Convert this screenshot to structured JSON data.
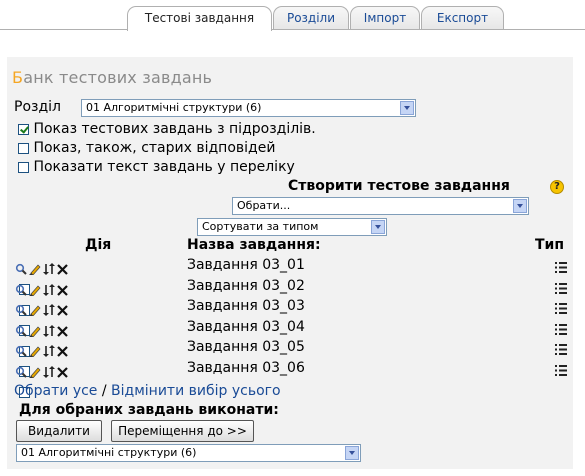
{
  "tabs": [
    {
      "label": "Тестові завдання",
      "active": true
    },
    {
      "label": "Розділи",
      "active": false
    },
    {
      "label": "Імпорт",
      "active": false
    },
    {
      "label": "Експорт",
      "active": false
    }
  ],
  "heading": {
    "first_letter": "Б",
    "rest": "анк тестових завдань"
  },
  "category": {
    "label": "Розділ",
    "selected": "01 Алгоритмічні структури (6)"
  },
  "options": [
    {
      "label": "Показ тестових завдань з підрозділів.",
      "checked": true
    },
    {
      "label": "Показ, також, старих відповідей",
      "checked": false
    },
    {
      "label": "Показати текст завдань у переліку",
      "checked": false
    }
  ],
  "create": {
    "label": "Створити тестове завдання",
    "select_value": "Обрати...",
    "help_icon": "question-icon"
  },
  "sort": {
    "selected": "Сортувати за типом"
  },
  "table": {
    "col_action": "Дія",
    "col_name": "Назва завдання:",
    "col_type": "Тип",
    "rows": [
      {
        "name": "Завдання 03_01"
      },
      {
        "name": "Завдання 03_02"
      },
      {
        "name": "Завдання 03_03"
      },
      {
        "name": "Завдання 03_04"
      },
      {
        "name": "Завдання 03_05"
      },
      {
        "name": "Завдання 03_06"
      }
    ]
  },
  "select_all": "Обрати усе",
  "separator": "/",
  "deselect_all": "Відмінити вибір усього",
  "bulk": {
    "label": "Для обраних завдань виконати:",
    "delete_button": "Видалити",
    "move_button": "Переміщення до >>",
    "target_selected": "01 Алгоритмічні структури (6)"
  },
  "colors": {
    "accent": "#1a4b96",
    "heading_first": "#f5a623",
    "panel_bg": "#f2f2f2"
  }
}
